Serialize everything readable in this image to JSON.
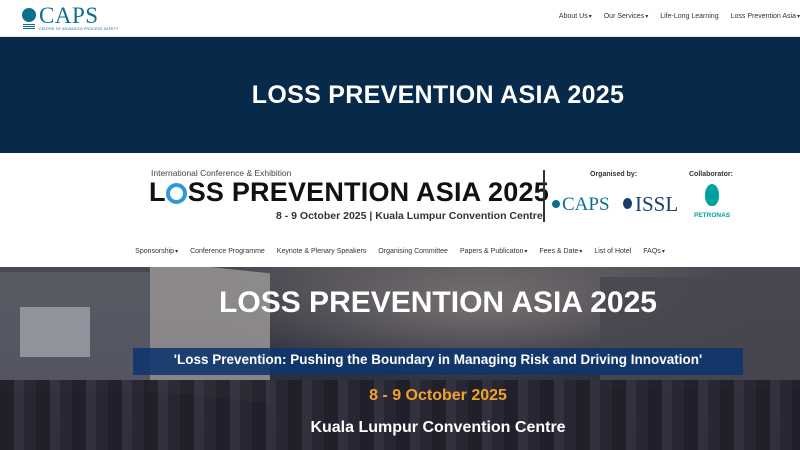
{
  "nav": {
    "logo_text": "CAPS",
    "logo_sub": "CENTRE OF ADVANCED PROCESS SAFETY",
    "items": [
      "About Us",
      "Our Services",
      "Life-Long Learning",
      "Loss Prevention Asia"
    ],
    "caret": "▾"
  },
  "hero": {
    "title": "LOSS PREVENTION ASIA 2025"
  },
  "conference": {
    "small": "International Conference & Exhibition",
    "big_l": "L",
    "big_rest": "SS PREVENTION ASIA 2025",
    "date": "8 - 9 October 2025 | Kuala Lumpur Convention Centre",
    "organised_by": "Organised by:",
    "collaborator": "Collaborator:",
    "org1": "CAPS",
    "org2": "ISSL",
    "org3": "PETRONAS"
  },
  "subnav": {
    "items": [
      "Sponsorship",
      "Conference Programme",
      "Keynote & Plenary Speakers",
      "Organising Committee",
      "Papers & Publicaton",
      "Fees & Date",
      "List of Hotel",
      "FAQs"
    ]
  },
  "photo": {
    "title": "LOSS PREVENTION ASIA 2025",
    "tagline": "'Loss Prevention: Pushing the Boundary in Managing Risk and Driving Innovation'",
    "date": "8 - 9 October 2025",
    "venue": "Kuala Lumpur Convention Centre"
  },
  "colors": {
    "navy": "#072a4a",
    "caps_teal": "#0d6f8e",
    "accent_orange": "#f0a32a",
    "tagline_blue": "#0c356e",
    "petronas": "#00a19c"
  }
}
